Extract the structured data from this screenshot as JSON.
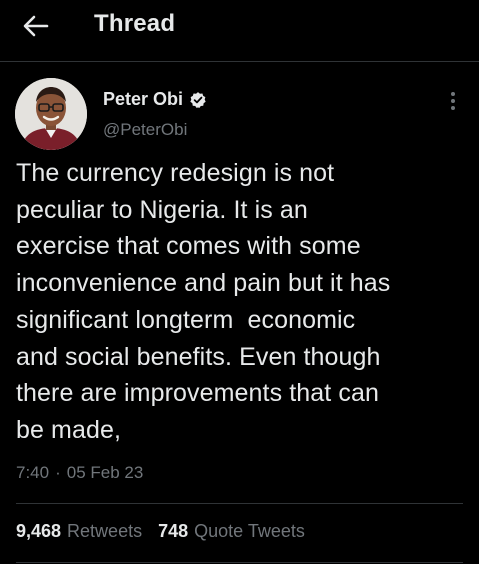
{
  "header": {
    "title": "Thread",
    "back_icon": "arrow-left-icon"
  },
  "tweet": {
    "author": {
      "name": "Peter Obi",
      "handle": "@PeterObi",
      "verified": true,
      "verified_icon": "verified-badge-icon"
    },
    "text": "The currency redesign is not\npeculiar to Nigeria. It is an\nexercise that comes with some\ninconvenience and pain but it has\nsignificant longterm  economic\nand social benefits. Even though\nthere are improvements that can\nbe made,",
    "time": "7:40",
    "separator": "·",
    "date": "05 Feb 23",
    "more_icon": "more-vertical-icon"
  },
  "stats": {
    "retweets_count": "9,468",
    "retweets_label": "Retweets",
    "quotes_count": "748",
    "quotes_label": "Quote Tweets"
  },
  "colors": {
    "background": "#000000",
    "text_primary": "#e7e9ea",
    "text_secondary": "#71767b",
    "divider": "#2f3336"
  }
}
